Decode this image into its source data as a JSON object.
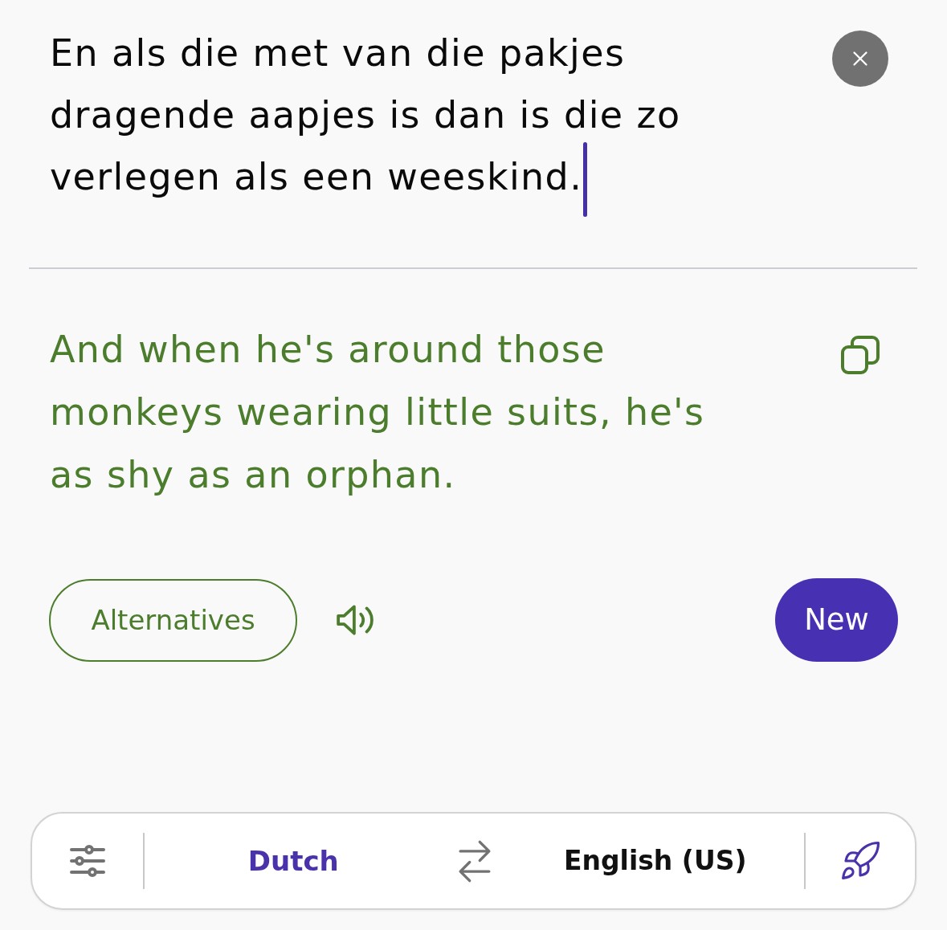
{
  "source": {
    "value": "En als die met van die pakjes dragende aapjes is dan is die zo verlegen als een weeskind.",
    "focused": true
  },
  "translation": {
    "text": "And when he's around those monkeys wearing little suits, he's as shy as an orphan."
  },
  "actions": {
    "alternatives": "Alternatives",
    "new": "New"
  },
  "language_bar": {
    "languages": [
      {
        "label": "Dutch",
        "selected": true
      },
      {
        "label": "English (US)",
        "selected": false
      }
    ]
  }
}
